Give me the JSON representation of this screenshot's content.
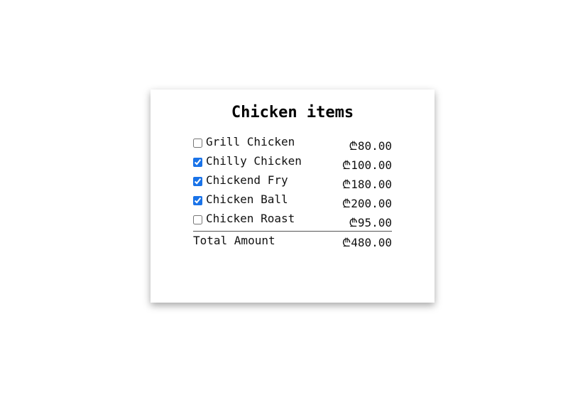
{
  "card": {
    "title": "Chicken items",
    "items": [
      {
        "label": "Grill Chicken",
        "price": "₾80.00",
        "checked": false
      },
      {
        "label": "Chilly Chicken",
        "price": "₾100.00",
        "checked": true
      },
      {
        "label": "Chickend Fry",
        "price": "₾180.00",
        "checked": true
      },
      {
        "label": "Chicken Ball",
        "price": "₾200.00",
        "checked": true
      },
      {
        "label": "Chicken Roast",
        "price": "₾95.00",
        "checked": false
      }
    ],
    "total_label": "Total Amount",
    "total_value": "₾480.00"
  },
  "colors": {
    "checkbox_accent": "#1a73e8"
  }
}
